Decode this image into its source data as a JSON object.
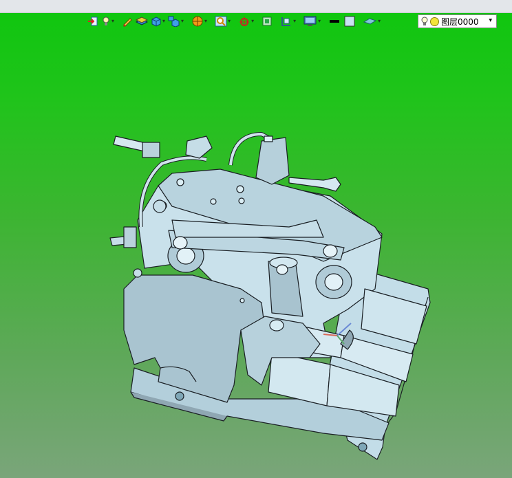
{
  "toolbar": {
    "buttons": [
      {
        "icon": "exit-icon",
        "dropdown": false
      },
      {
        "icon": "light-icon",
        "dropdown": true
      },
      {
        "icon": "pen-icon",
        "dropdown": false
      },
      {
        "icon": "layer-stack-icon",
        "dropdown": false
      },
      {
        "icon": "cube-view-icon",
        "dropdown": true
      },
      {
        "icon": "views-icon",
        "dropdown": true
      },
      {
        "icon": "render-sphere-icon",
        "dropdown": true
      },
      {
        "icon": "zoom-icon",
        "dropdown": true
      },
      {
        "icon": "origin-axis-icon",
        "dropdown": true
      },
      {
        "icon": "fit-view-icon",
        "dropdown": false
      },
      {
        "icon": "section-plane-icon",
        "dropdown": true
      },
      {
        "icon": "display-monitor-icon",
        "dropdown": true
      },
      {
        "icon": "line-color-icon",
        "dropdown": false
      },
      {
        "icon": "fill-color-icon",
        "dropdown": false
      },
      {
        "icon": "surface-icon",
        "dropdown": true
      }
    ]
  },
  "layer": {
    "label": "图层0000"
  },
  "colors": {
    "background_top": "#0ec60e",
    "background_bottom": "#7aa57a",
    "model_face": "#c6e0ea",
    "model_shadow": "#8fa7b3",
    "model_edge": "#1a1f24"
  }
}
